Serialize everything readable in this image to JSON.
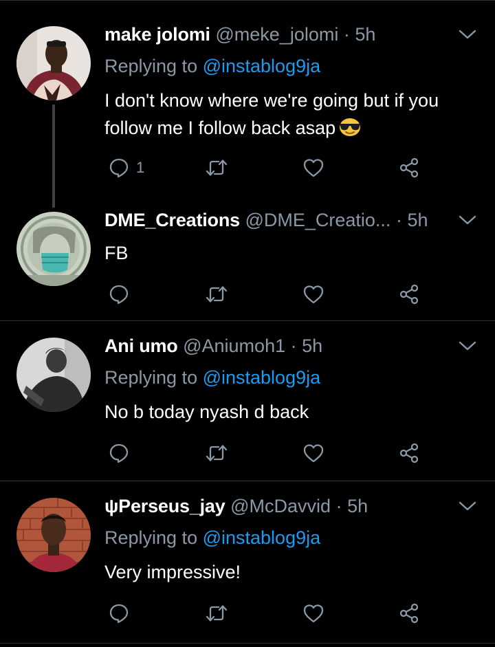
{
  "tweets": [
    {
      "display_name": "make jolomi",
      "handle": "@meke_jolomi",
      "separator": "·",
      "time": "5h",
      "replying_prefix": "Replying to ",
      "replying_mention": "@instablog9ja",
      "text_line1": "I don't know where we're going but if you",
      "text_line2": "follow me I follow back asap",
      "emoji": "sunglasses-emoji",
      "reply_count": "1"
    },
    {
      "display_name": "DME_Creations",
      "handle": "@DME_Creatio...",
      "separator": "·",
      "time": "5h",
      "text": "FB"
    },
    {
      "display_name": "Ani umo",
      "handle": "@Aniumoh1",
      "separator": "·",
      "time": "5h",
      "replying_prefix": "Replying to ",
      "replying_mention": "@instablog9ja",
      "text": "No b today nyash d back"
    },
    {
      "display_name": "ψPerseus_jay",
      "handle": "@McDavvid",
      "separator": "·",
      "time": "5h",
      "replying_prefix": "Replying to ",
      "replying_mention": "@instablog9ja",
      "text": "Very impressive!"
    }
  ],
  "icons": {
    "reply": "reply-icon",
    "retweet": "retweet-icon",
    "like": "like-icon",
    "share": "share-icon",
    "more": "chevron-down-icon"
  },
  "colors": {
    "background": "#000000",
    "text": "#ffffff",
    "secondary": "#8b98a5",
    "mention": "#1d9bf0",
    "divider": "#2f3336"
  }
}
